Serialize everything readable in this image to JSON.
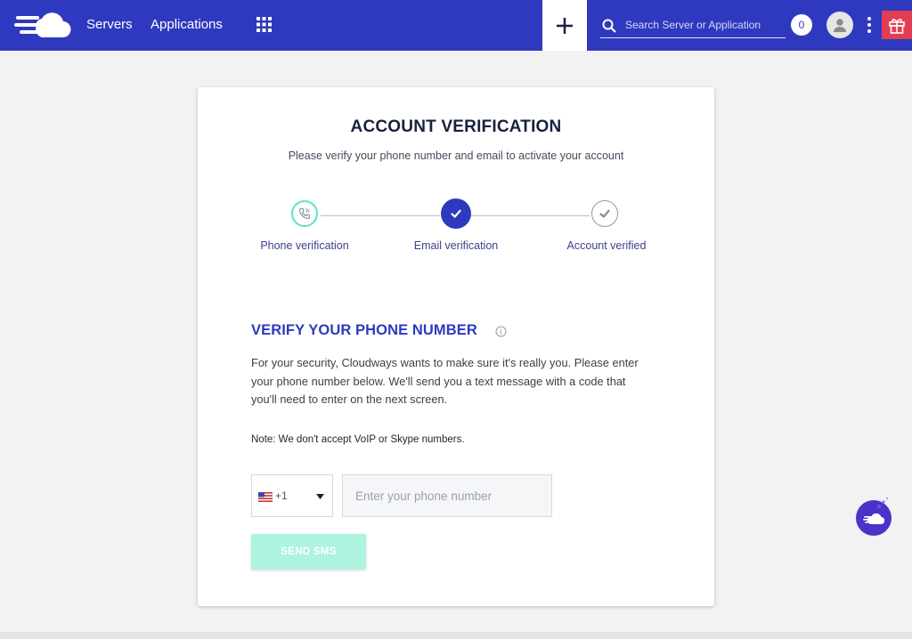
{
  "header": {
    "nav_servers": "Servers",
    "nav_applications": "Applications",
    "search_placeholder": "Search Server or Application",
    "notification_count": "0",
    "icons": [
      "cloudways-logo-icon",
      "apps-grid-icon",
      "plus-icon",
      "search-icon",
      "avatar-icon",
      "kebab-menu-icon",
      "gift-icon"
    ],
    "colors": {
      "bar": "#2f39bf",
      "gift": "#e33d52"
    }
  },
  "card": {
    "title": "ACCOUNT VERIFICATION",
    "subtitle": "Please verify your phone number and email to activate your account",
    "steps": [
      {
        "label": "Phone verification",
        "icon": "phone-icon",
        "state": "current"
      },
      {
        "label": "Email verification",
        "icon": "check-icon",
        "state": "completed"
      },
      {
        "label": "Account verified",
        "icon": "check-icon",
        "state": "pending"
      }
    ],
    "section_title": "VERIFY YOUR PHONE NUMBER",
    "description": "For your security, Cloudways wants to make sure it's really you. Please enter your phone number below. We'll send you a text message with a code that you'll need to enter on the next screen.",
    "note": "Note: We don't accept VoIP or Skype numbers.",
    "country_code": "+1",
    "phone_placeholder": "Enter your phone number",
    "send_button": "SEND SMS",
    "colors": {
      "accent": "#2f39bf",
      "step_current": "#5ce5c0",
      "button": "#aef3df"
    }
  }
}
